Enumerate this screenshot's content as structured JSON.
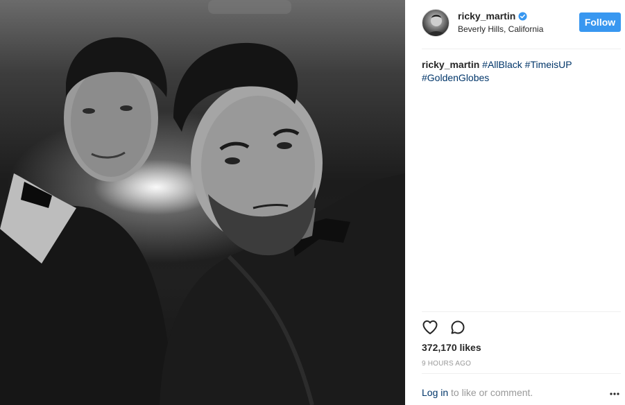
{
  "post": {
    "image_alt": "Black-and-white selfie of two men in tuxedos with bow ties in the back of a car"
  },
  "header": {
    "username": "ricky_martin",
    "verified": true,
    "location": "Beverly Hills, California",
    "follow_label": "Follow"
  },
  "caption": {
    "username": "ricky_martin",
    "hashtags": [
      "#AllBlack",
      "#TimeisUP",
      "#GoldenGlobes"
    ]
  },
  "actions": {
    "like_icon": "heart-icon",
    "comment_icon": "comment-icon"
  },
  "stats": {
    "likes_text": "372,170 likes",
    "time_text": "9 HOURS AGO"
  },
  "footer": {
    "login_link": "Log in",
    "login_suffix": " to like or comment.",
    "more_icon": "more-options-icon"
  },
  "colors": {
    "accent": "#3897f0",
    "link": "#003569",
    "muted": "#999999",
    "text": "#262626",
    "divider": "#efefef"
  }
}
